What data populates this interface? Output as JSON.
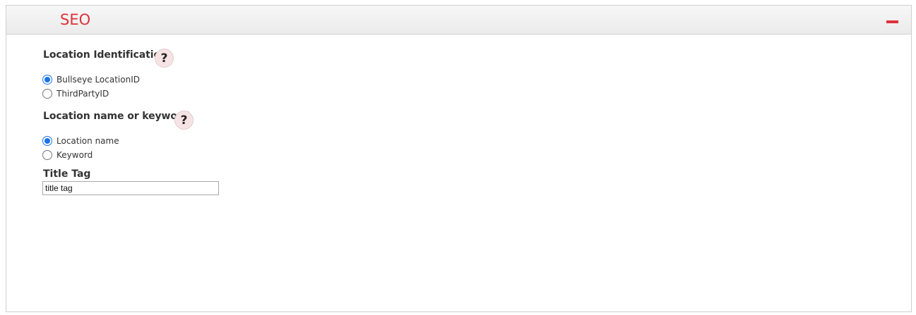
{
  "panel": {
    "title": "SEO",
    "collapse_icon": "minus-icon",
    "accent_color": "#e0303a"
  },
  "location_identification": {
    "label": "Location Identification",
    "help_icon": "help-question-icon",
    "help_glyph": "?",
    "options": [
      {
        "label": "Bullseye LocationID",
        "checked": true
      },
      {
        "label": "ThirdPartyID",
        "checked": false
      }
    ]
  },
  "location_name_keyword": {
    "label": "Location name or keyword",
    "help_icon": "help-question-icon",
    "help_glyph": "?",
    "options": [
      {
        "label": "Location name",
        "checked": true
      },
      {
        "label": "Keyword",
        "checked": false
      }
    ]
  },
  "title_tag": {
    "label": "Title Tag",
    "value": "title tag"
  }
}
